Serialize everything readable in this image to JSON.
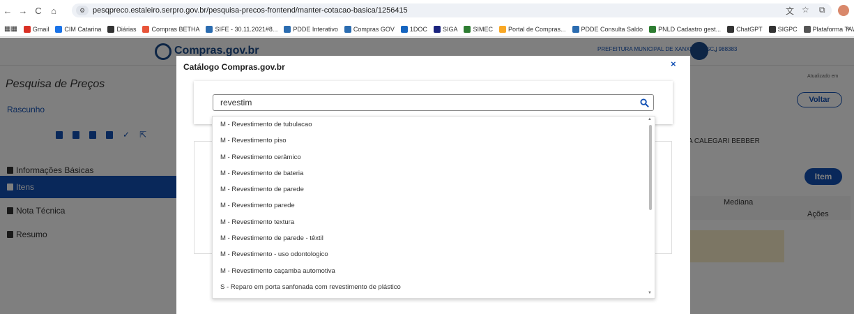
{
  "browser": {
    "url": "pesqpreco.estaleiro.serpro.gov.br/pesquisa-precos-frontend/manter-cotacao-basica/1256415",
    "bookmarks": [
      {
        "label": "Gmail",
        "color": "#d93025"
      },
      {
        "label": "CIM Catarina",
        "color": "#1a73e8"
      },
      {
        "label": "Diárias",
        "color": "#333333"
      },
      {
        "label": "Compras BETHA",
        "color": "#e8553a"
      },
      {
        "label": "SIFE - 30.11.2021#8...",
        "color": "#2b6cb0"
      },
      {
        "label": "PDDE Interativo",
        "color": "#2b6cb0"
      },
      {
        "label": "Compras GOV",
        "color": "#2b6cb0"
      },
      {
        "label": "1DOC",
        "color": "#1565c0"
      },
      {
        "label": "SIGA",
        "color": "#1a237e"
      },
      {
        "label": "SIMEC",
        "color": "#2e7d32"
      },
      {
        "label": "Portal de Compras...",
        "color": "#f9a825"
      },
      {
        "label": "PDDE Consulta Saldo",
        "color": "#2b6cb0"
      },
      {
        "label": "PNLD Cadastro gest...",
        "color": "#2e7d32"
      },
      {
        "label": "ChatGPT",
        "color": "#333333"
      },
      {
        "label": "SIGPC",
        "color": "#333333"
      },
      {
        "label": "Plataforma TAW",
        "color": "#555555"
      }
    ],
    "more": "»"
  },
  "app": {
    "logo_text": "Compras.gov.br",
    "prefeitura": "PREFEITURA MUNICIPAL DE XANXERÊ - SC | 988383",
    "page_title": "Pesquisa de Preços",
    "status": "Rascunho",
    "updated_label": "Atualizado em",
    "voltar": "Voltar",
    "author_partial": "A CALEGARI BEBBER",
    "item_button": "Item",
    "col_mediana": "Mediana",
    "col_acoes": "Ações",
    "sidebar": [
      {
        "label": "Informações Básicas",
        "active": false
      },
      {
        "label": "Itens",
        "active": true
      },
      {
        "label": "Nota Técnica",
        "active": false
      },
      {
        "label": "Resumo",
        "active": false
      }
    ]
  },
  "modal": {
    "title": "Catálogo Compras.gov.br",
    "close": "×",
    "search_value": "revestim",
    "suggestions": [
      "M - Revestimento de tubulacao",
      "M - Revestimento piso",
      "M - Revestimento cerâmico",
      "M - Revestimento de bateria",
      "M - Revestimento de parede",
      "M - Revestimento parede",
      "M - Revestimento textura",
      "M - Revestimento de parede - têxtil",
      "M - Revestimento - uso odontologico",
      "M - Revestimento caçamba automotiva",
      "S - Reparo em porta sanfonada com revestimento de plástico"
    ]
  }
}
